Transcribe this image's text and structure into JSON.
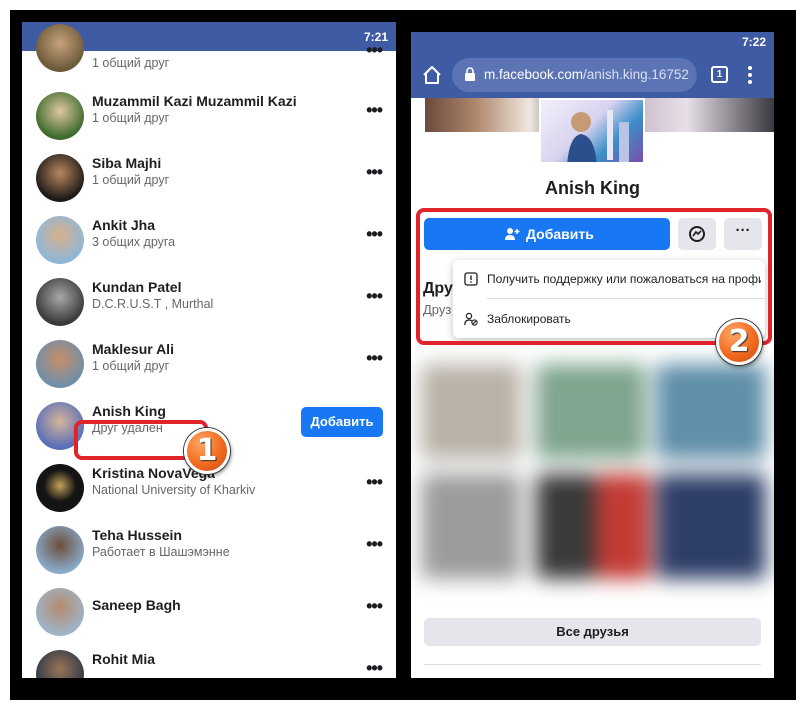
{
  "left_screen": {
    "status_time": "7:21",
    "friends": [
      {
        "name": "",
        "subtitle": "1 общий друг",
        "action": "more"
      },
      {
        "name": "Muzammil Kazi Muzammil Kazi",
        "subtitle": "1 общий друг",
        "action": "more"
      },
      {
        "name": "Siba Majhi",
        "subtitle": "1 общий друг",
        "action": "more"
      },
      {
        "name": "Ankit Jha",
        "subtitle": "3 общих друга",
        "action": "more"
      },
      {
        "name": "Kundan Patel",
        "subtitle": "D.C.R.U.S.T , Murthal",
        "action": "more"
      },
      {
        "name": "Maklesur Ali",
        "subtitle": "1 общий друг",
        "action": "more"
      },
      {
        "name": "Anish King",
        "subtitle": "Друг удален",
        "action": "add"
      },
      {
        "name": "Kristina NovaVega",
        "subtitle": "National University of Kharkiv",
        "action": "more"
      },
      {
        "name": "Teha Hussein",
        "subtitle": "Работает в Шашэмэнне",
        "action": "more"
      },
      {
        "name": "Saneep Bagh",
        "subtitle": "",
        "action": "more"
      },
      {
        "name": "Rohit Mia",
        "subtitle": "",
        "action": "more"
      }
    ],
    "more_label": "•••",
    "add_label": "Добавить"
  },
  "right_screen": {
    "status_time": "7:22",
    "url_domain": "m.facebook.com",
    "url_path": "/anish.king.16752",
    "tab_count": "1",
    "profile_name": "Anish King",
    "add_button_label": "Добавить",
    "more_label": "···",
    "friends_heading": "Дру",
    "friends_sub": "Друз",
    "dropdown": [
      {
        "label": "Получить поддержку или пожаловаться на профи...",
        "icon": "report-icon"
      },
      {
        "label": "Заблокировать",
        "icon": "block-user-icon"
      }
    ],
    "all_friends_label": "Все друзья"
  },
  "annotations": {
    "step1": "1",
    "step2": "2",
    "highlight_color": "#e0242a",
    "badge_color": "#f26a1f"
  },
  "colors": {
    "status_bar": "#3f5ba3",
    "fb_blue": "#1877f2",
    "grey_button": "#e4e6eb"
  }
}
